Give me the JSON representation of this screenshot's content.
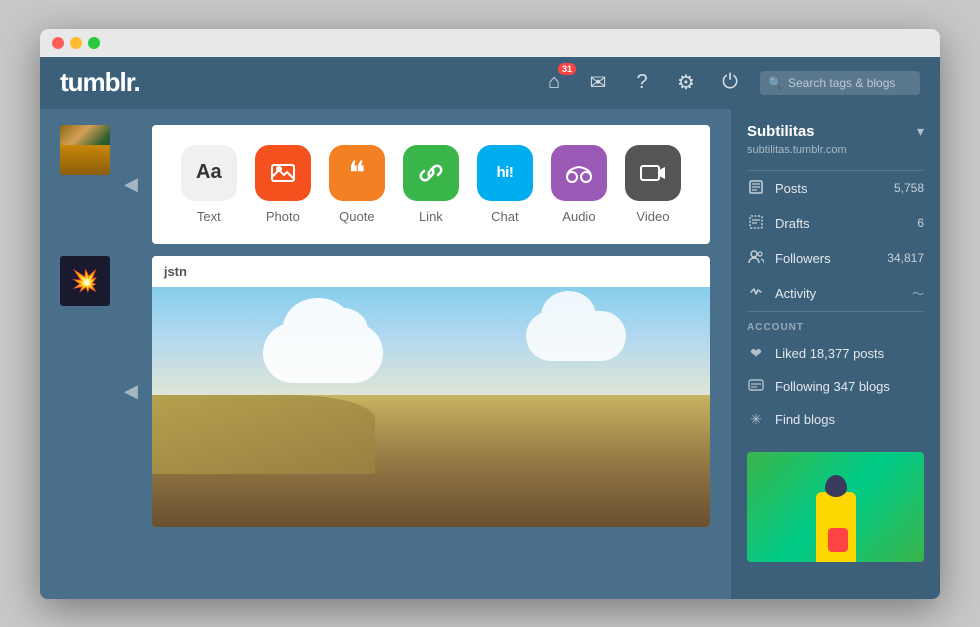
{
  "window": {
    "title": "Tumblr"
  },
  "titlebar": {
    "lights": [
      "red",
      "yellow",
      "green"
    ]
  },
  "nav": {
    "logo": "tumblr.",
    "badge_count": "31",
    "search_placeholder": "Search tags & blogs",
    "icons": {
      "home": "⌂",
      "mail": "✉",
      "help": "?",
      "settings": "⚙",
      "power": "⏻"
    }
  },
  "create_post": {
    "types": [
      {
        "key": "text",
        "label": "Text",
        "symbol": "Aa"
      },
      {
        "key": "photo",
        "label": "Photo",
        "symbol": "📷"
      },
      {
        "key": "quote",
        "label": "Quote",
        "symbol": "❝"
      },
      {
        "key": "link",
        "label": "Link",
        "symbol": "🔗"
      },
      {
        "key": "chat",
        "label": "Chat",
        "symbol": "hi!"
      },
      {
        "key": "audio",
        "label": "Audio",
        "symbol": "🎧"
      },
      {
        "key": "video",
        "label": "Video",
        "symbol": "🎥"
      }
    ]
  },
  "feed_post": {
    "username": "jstn"
  },
  "sidebar": {
    "blog_name": "Subtilitas",
    "blog_url": "subtilitas.tumblr.com",
    "stats": [
      {
        "key": "posts",
        "label": "Posts",
        "value": "5,758",
        "icon": "📄"
      },
      {
        "key": "drafts",
        "label": "Drafts",
        "value": "6",
        "icon": "📋"
      },
      {
        "key": "followers",
        "label": "Followers",
        "value": "34,817",
        "icon": "👥"
      },
      {
        "key": "activity",
        "label": "Activity",
        "value": "~",
        "icon": "⚡"
      }
    ],
    "account_label": "ACCOUNT",
    "account_items": [
      {
        "key": "liked",
        "label": "Liked 18,377 posts",
        "icon": "❤"
      },
      {
        "key": "following",
        "label": "Following 347 blogs",
        "icon": "🔁"
      },
      {
        "key": "find",
        "label": "Find blogs",
        "icon": "✳"
      }
    ]
  }
}
